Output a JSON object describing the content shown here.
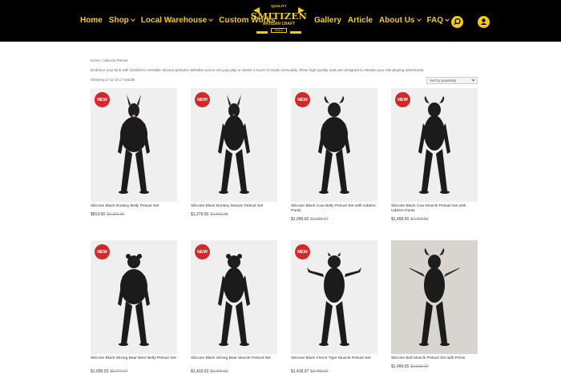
{
  "nav": {
    "left": [
      {
        "label": "Home",
        "dropdown": false
      },
      {
        "label": "Shop",
        "dropdown": true
      },
      {
        "label": "Local Warehouse",
        "dropdown": true
      },
      {
        "label": "Custom Works",
        "dropdown": false
      }
    ],
    "right": [
      {
        "label": "Gallery",
        "dropdown": false
      },
      {
        "label": "Article",
        "dropdown": false
      },
      {
        "label": "About Us",
        "dropdown": true
      },
      {
        "label": "FAQ",
        "dropdown": true
      }
    ],
    "search_icon": "search-icon",
    "account_icon": "user-icon",
    "accent_color": "#f2cb16"
  },
  "logo": {
    "top": "QUALITY",
    "name": "SMITIZEN",
    "sub": "ARTISAN CRAFT",
    "bottom": "SINCE"
  },
  "breadcrumb": "Home / Silicone Petsuit",
  "intro": "Embrace your kink with Smitizen's versatile silicone petsuits! Whether you're into pup play or desire a touch of exotic sensuality, these high-quality suits are designed to elevate your role-playing adventures.",
  "result_count": "Showing 1–12 of 17 results",
  "sort": {
    "selected": "Sort by popularity"
  },
  "badge_color": "#d3282a",
  "products": [
    {
      "title": "Silicone Black Donkey Belly Petsuit Set",
      "price": "$819.00",
      "old_price": "$2,131.25",
      "badge": "NEW",
      "figure": "donkey",
      "belly": true
    },
    {
      "title": "Silicone Black Donkey Muscle Petsuit Set",
      "price": "$1,279.00",
      "old_price": "$2,500.25",
      "badge": "NEW",
      "figure": "donkey",
      "belly": false
    },
    {
      "title": "Silicone Black Cow Belly Petsuit Set with Udders Pants",
      "price": "$1,099.00",
      "old_price": "$2,096.47",
      "badge": "NEW",
      "figure": "cow",
      "belly": true
    },
    {
      "title": "Silicone Black Cow Muscle Petsuit Set with Udders Pants",
      "price": "$1,499.00",
      "old_price": "$2,769.92",
      "badge": "NEW",
      "figure": "cow",
      "belly": false
    },
    {
      "title": "Silicone Black Strong Bear Beer Belly Petsuit Set",
      "price": "$1,099.03",
      "old_price": "$1,777.47",
      "badge": "NEW",
      "figure": "bear",
      "belly": true
    },
    {
      "title": "Silicone Black Strong Bear Muscle Petsuit Set",
      "price": "$1,419.03",
      "old_price": "$2,469.92",
      "badge": "NEW",
      "figure": "bear",
      "belly": false
    },
    {
      "title": "Silicone Black Fierce Tiger Muscle Petsuit Set",
      "price": "$1,418.97",
      "old_price": "$2,469.92",
      "badge": "NEW",
      "figure": "tiger",
      "belly": false
    },
    {
      "title": "Silicone Bull Muscle Petsuit Set with Penis",
      "price": "$1,499.05",
      "old_price": "$2,533.29",
      "badge": "",
      "figure": "bull",
      "belly": false
    }
  ]
}
